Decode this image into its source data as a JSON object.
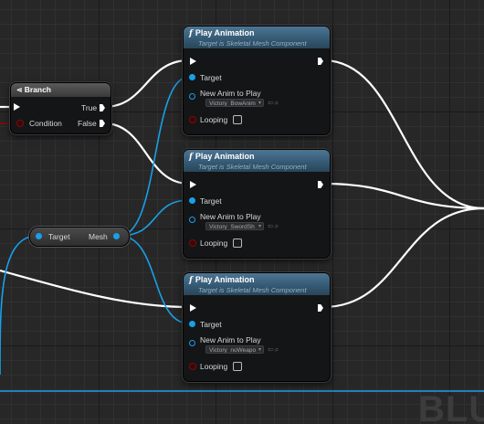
{
  "branch": {
    "title": "Branch",
    "icon": "branch-icon",
    "condition_label": "Condition",
    "true_label": "True",
    "false_label": "False"
  },
  "getter": {
    "target_label": "Target",
    "mesh_label": "Mesh"
  },
  "play_animation_nodes": [
    {
      "title": "Play Animation",
      "subtitle": "Target is Skeletal Mesh Component",
      "target_label": "Target",
      "anim_label": "New Anim to Play",
      "anim_value": "Victory_BowAnim",
      "looping_label": "Looping"
    },
    {
      "title": "Play Animation",
      "subtitle": "Target is Skeletal Mesh Component",
      "target_label": "Target",
      "anim_label": "New Anim to Play",
      "anim_value": "Victory_SwordSh",
      "looping_label": "Looping"
    },
    {
      "title": "Play Animation",
      "subtitle": "Target is Skeletal Mesh Component",
      "target_label": "Target",
      "anim_label": "New Anim to Play",
      "anim_value": "Victory_noWeapo",
      "looping_label": "Looping"
    }
  ],
  "watermark": "BLU",
  "colors": {
    "exec_wire": "#ffffff",
    "object_wire": "#18a0e8",
    "bool_pin": "#7a0d0d",
    "node_header": "#355a75"
  },
  "icons": {
    "function": "function-icon",
    "exec_pin": "exec-pin-icon",
    "object_pin": "object-pin-icon",
    "dropdown": "dropdown-arrow-icon",
    "browse": "browse-arrow-icon",
    "search": "search-icon"
  }
}
